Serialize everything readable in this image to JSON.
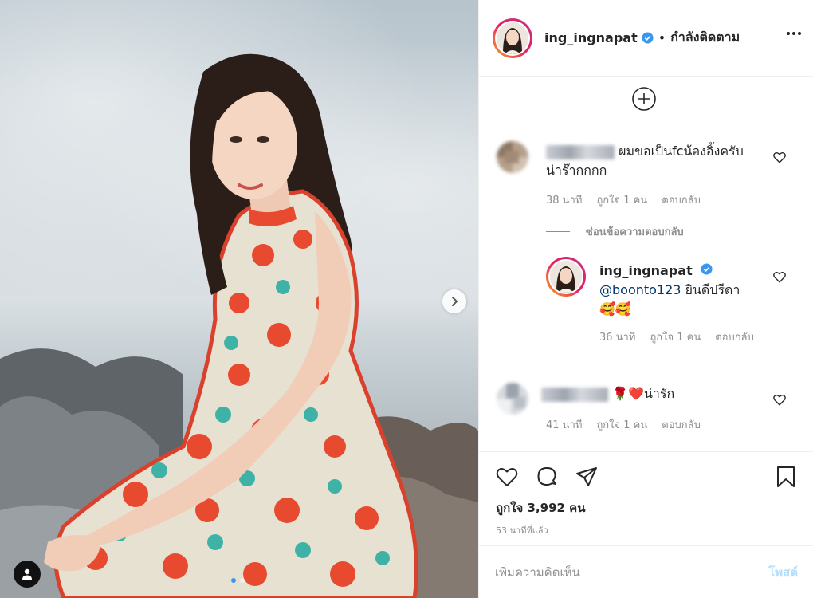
{
  "header": {
    "username": "ing_ingnapat",
    "separator": "•",
    "follow_status": "กำลังติดตาม",
    "icons": [
      "verified-badge-icon",
      "more-options-icon"
    ]
  },
  "load_more_icon": "plus-circle-icon",
  "comments": [
    {
      "text": "ผมขอเป็นfcน้องอิ้งครับ น่าร๊ากกกก",
      "time": "38 นาที",
      "likes": "ถูกใจ 1 คน",
      "reply": "ตอบกลับ"
    }
  ],
  "hide_replies": "ซ่อนข้อความตอบกลับ",
  "reply_comment": {
    "username": "ing_ingnapat",
    "mention": "@boonto123",
    "text": " ยินดีปรีดา",
    "emoji": "🥰🥰",
    "time": "36 นาที",
    "likes": "ถูกใจ 1 คน",
    "reply": "ตอบกลับ"
  },
  "comment2": {
    "text_emoji": "🌹❤️",
    "text": "น่ารัก",
    "time": "41 นาที",
    "likes": "ถูกใจ 1 คน",
    "reply": "ตอบกลับ"
  },
  "likes_count": "ถูกใจ 3,992 คน",
  "posted_time": "53 นาทีที่แล้ว",
  "add_comment": {
    "placeholder": "เพิ่มความคิดเห็น",
    "post_label": "โพสต์"
  },
  "colors": {
    "accent": "#3897f0",
    "post_disabled": "#b2dffc",
    "muted": "#8e8e8e",
    "text": "#262626",
    "dress_red": "#e84a2f",
    "dress_teal": "#3fb2a8"
  },
  "carousel": {
    "current": 1,
    "total": 2
  }
}
